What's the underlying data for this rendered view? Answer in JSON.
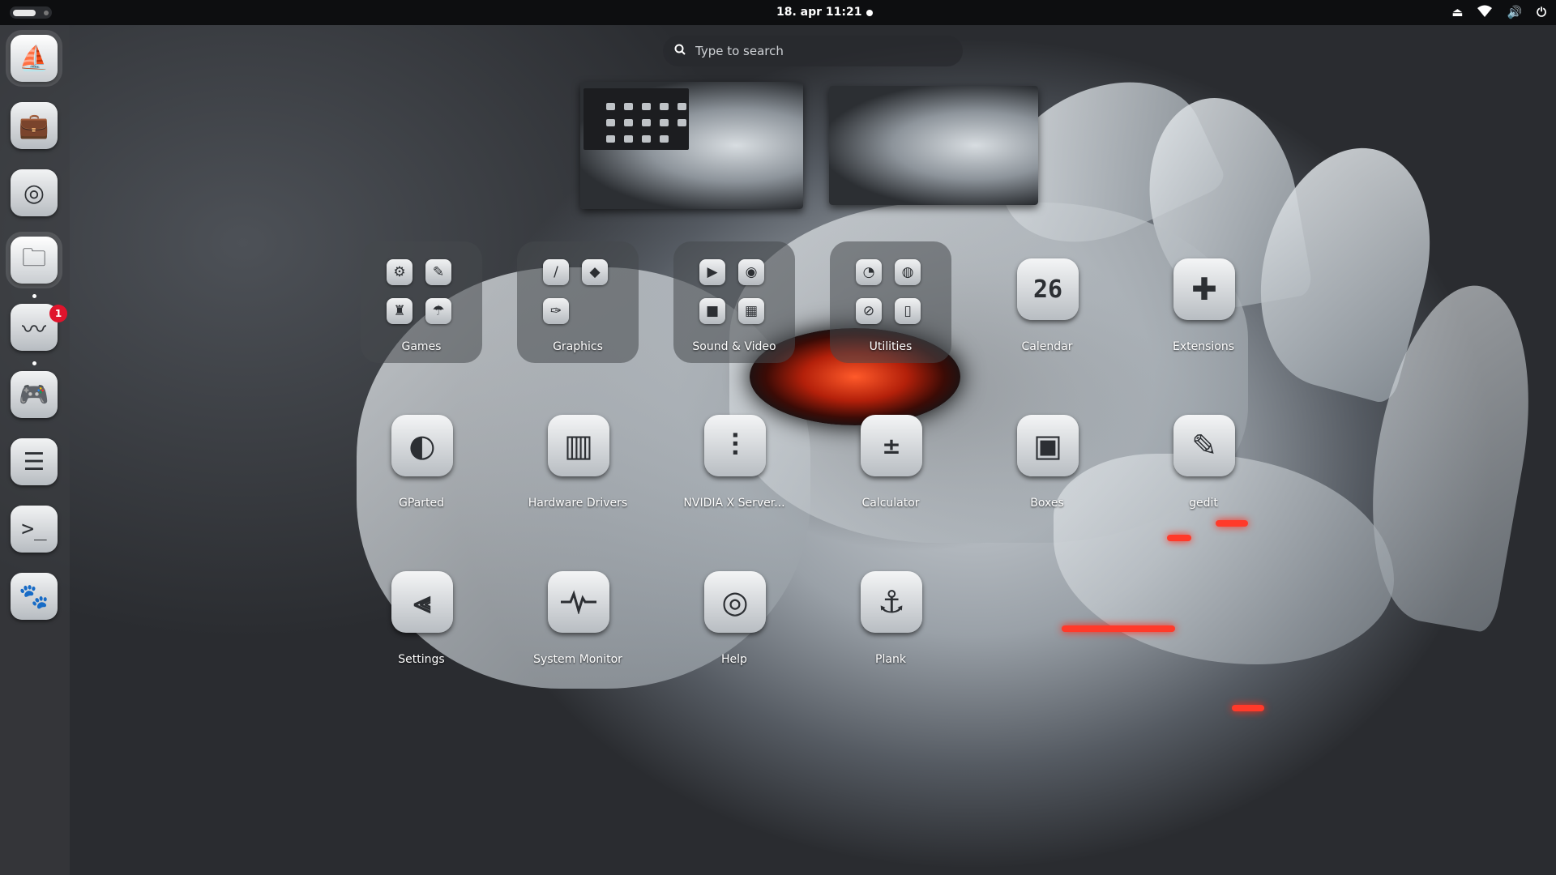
{
  "topbar": {
    "clock": "18. apr  11:21",
    "tray_icons": [
      "eject-icon",
      "wifi-icon",
      "volume-icon",
      "power-icon"
    ]
  },
  "search": {
    "placeholder": "Type to search"
  },
  "dock": {
    "items": [
      {
        "name": "sailboat-icon"
      },
      {
        "name": "software-store-icon"
      },
      {
        "name": "browser-icon"
      },
      {
        "name": "files-icon"
      },
      {
        "name": "rss-reader-icon",
        "badge": "1"
      },
      {
        "name": "gamepad-icon"
      },
      {
        "name": "layers-icon"
      },
      {
        "name": "terminal-icon"
      },
      {
        "name": "gnome-tweaks-icon"
      }
    ]
  },
  "workspaces": [
    "workspace-1",
    "workspace-2"
  ],
  "apps": {
    "row1": [
      "Games",
      "Graphics",
      "Sound & Video",
      "Utilities",
      "Calendar",
      "Extensions"
    ],
    "row2": [
      "GParted",
      "Hardware Drivers",
      "NVIDIA X Server...",
      "Calculator",
      "Boxes",
      "gedit"
    ],
    "row3": [
      "Settings",
      "System Monitor",
      "Help",
      "Plank"
    ],
    "calendar_day": "26"
  },
  "colors": {
    "accent_red": "#e0142c",
    "topbar_bg": "#0d0e10"
  }
}
